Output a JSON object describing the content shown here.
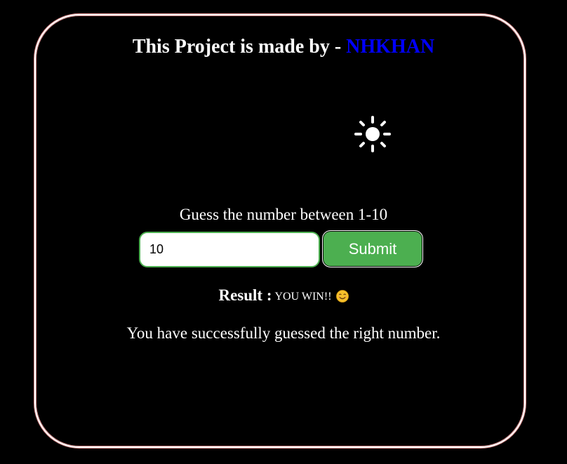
{
  "header": {
    "title_prefix": "This Project is made by - ",
    "author": "NHKHAN",
    "author_color": "#0000ff"
  },
  "theme_toggle": {
    "icon": "sun-icon"
  },
  "game": {
    "prompt": "Guess the number between 1-10",
    "input_value": "10",
    "submit_label": "Submit",
    "accent_color": "#4caf50"
  },
  "result": {
    "label": "Result :",
    "value": "YOU WIN!!",
    "emoji_icon": "smiling-face-icon",
    "message": "You have successfully guessed the right number."
  }
}
